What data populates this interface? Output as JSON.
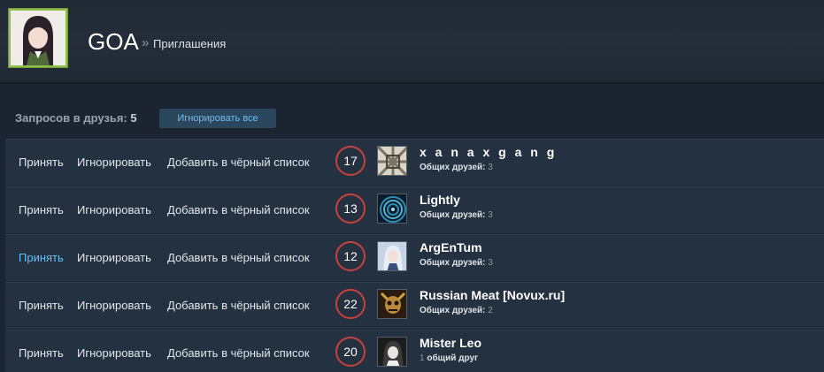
{
  "header": {
    "profile_name": "GOA",
    "breadcrumb_separator": "»",
    "page_title": "Приглашения"
  },
  "requests": {
    "label": "Запросов в друзья:",
    "count": "5",
    "ignore_all_label": "Игнорировать все"
  },
  "actions": {
    "accept": "Принять",
    "ignore": "Игнорировать",
    "block": "Добавить в чёрный список"
  },
  "colors": {
    "accent_link": "#66c0f4",
    "level_ring": "#c8423b",
    "row_bg": "#243140"
  },
  "friends": [
    {
      "level": "17",
      "name": "x a n a x g a n g",
      "mutual_label": "Общих друзей:",
      "mutual_count": "3",
      "avatar_icon": "pattern-avatar-icon"
    },
    {
      "level": "13",
      "name": "Lightly",
      "mutual_label": "Общих друзей:",
      "mutual_count": "3",
      "avatar_icon": "spiral-avatar-icon"
    },
    {
      "level": "12",
      "name": "ArgEnTum",
      "mutual_label": "Общих друзей:",
      "mutual_count": "3",
      "avatar_icon": "anime-avatar-icon"
    },
    {
      "level": "22",
      "name": "Russian Meat [Novux.ru]",
      "mutual_label": "Общих друзей:",
      "mutual_count": "2",
      "avatar_icon": "skull-avatar-icon"
    },
    {
      "level": "20",
      "name": "Mister Leo",
      "mutual_count": "1",
      "mutual_label": "общий друг",
      "avatar_icon": "person-avatar-icon"
    }
  ]
}
